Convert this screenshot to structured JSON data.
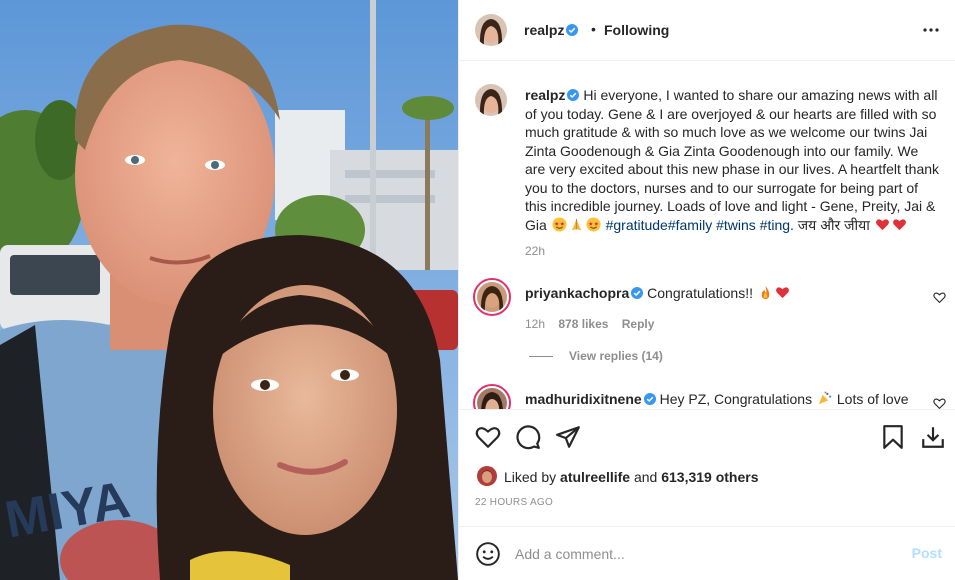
{
  "post": {
    "author": "realpz",
    "separator": "•",
    "follow_status": "Following",
    "photo_alt_text_visible": "MIYA"
  },
  "caption": {
    "username": "realpz",
    "text": "Hi everyone, I wanted to share our amazing news with all of you today. Gene & I are overjoyed & our hearts are filled with so much gratitude & with so much love as we welcome our twins Jai Zinta Goodenough & Gia Zinta Goodenough into our family. We are very excited about this new phase in our lives. A heartfelt thank you to the doctors, nurses and to our surrogate for being part of this incredible journey. Loads of love and light - Gene, Preity, Jai & Gia",
    "tags": "#gratitude#family #twins #ting.",
    "hindi": "जय और जीया",
    "time": "22h"
  },
  "comments": [
    {
      "username": "priyankachopra",
      "text": "Congratulations!!",
      "time": "12h",
      "likes": "878 likes",
      "reply_label": "Reply",
      "view_replies": "View replies (14)"
    },
    {
      "username": "madhuridixitnene",
      "text": "Hey PZ, Congratulations",
      "text_tail": "Lots of love"
    }
  ],
  "likes": {
    "prefix": "Liked by",
    "first_liker": "atulreellife",
    "joiner": "and",
    "others": "613,319 others"
  },
  "time_ago": "22 HOURS AGO",
  "comment_box": {
    "placeholder": "Add a comment...",
    "post_label": "Post"
  },
  "colors": {
    "link": "#00376b",
    "muted": "#8e8e8e",
    "verified": "#3897f0",
    "post_disabled": "#b2dffc",
    "heart": "#ed4956"
  }
}
